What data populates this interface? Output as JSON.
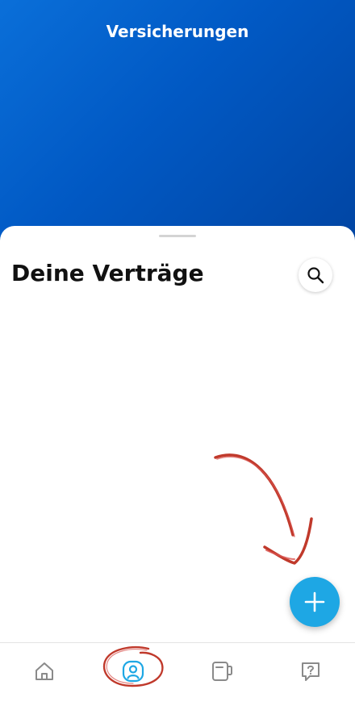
{
  "header": {
    "title": "Versicherungen"
  },
  "contracts": {
    "title": "Deine Verträge",
    "search_icon": "search-icon"
  },
  "fab": {
    "icon": "plus-icon"
  },
  "bottom_nav": {
    "items": [
      {
        "id": "home",
        "icon": "home-icon"
      },
      {
        "id": "profile",
        "icon": "user-circle-icon",
        "active": true
      },
      {
        "id": "contracts",
        "icon": "folder-icon"
      },
      {
        "id": "help",
        "icon": "help-chat-icon"
      }
    ]
  },
  "colors": {
    "header_gradient": [
      "#0a6fd9",
      "#0145a3"
    ],
    "accent": "#1ea7e4",
    "nav_icon": "#8a8a8a",
    "annotation": "#c0392b"
  }
}
